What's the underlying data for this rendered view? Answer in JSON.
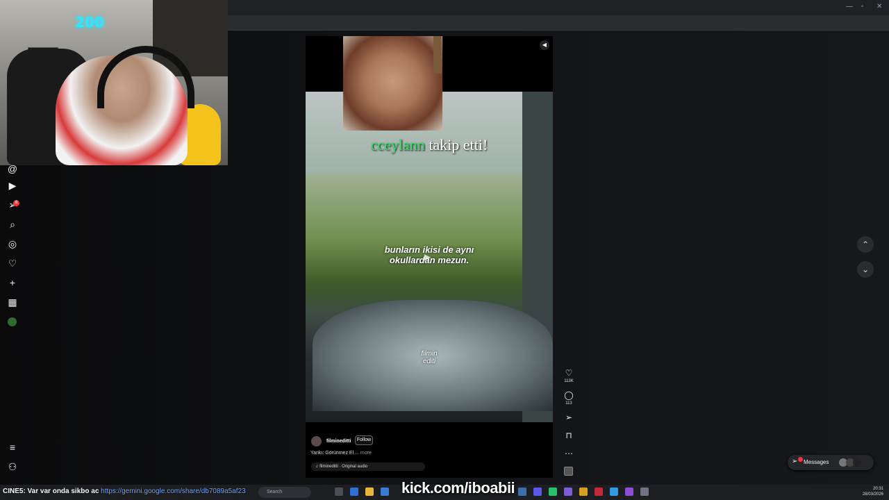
{
  "reel": {
    "follow_alert_user": "cceylann",
    "follow_alert_text": "takip etti!",
    "caption_line1": "bunların ikisi de aynı",
    "caption_line2": "okullardan mezun.",
    "watermark_line1": "filmin",
    "watermark_line2": "editi",
    "author": "filmineditti",
    "follow_label": "Follow",
    "description": "Yankı: Görünmez El ...",
    "more_label": "more",
    "audio": "filmineditti · Original audio"
  },
  "actions": {
    "like_count": "113K",
    "comment_count": "113"
  },
  "messages": {
    "label": "Messages"
  },
  "webcam": {
    "neon_text": "200"
  },
  "taskbar": {
    "search_placeholder": "Search",
    "time": "20:31",
    "date": "28/03/2026"
  },
  "overlay": {
    "chat_user": "CINE5",
    "chat_text": ": Var var onda sikbo ac",
    "chat_link": "https://gemini.google.com/share/db7089a5af23",
    "kick_text": "kick.com/iboabii"
  },
  "colors": {
    "follow_user_green": "#35e06a",
    "badge_red": "#ff3040",
    "link_blue": "#6ea6ff"
  },
  "icons": {
    "nav": [
      "threads-icon",
      "reels-icon",
      "send-icon",
      "search-icon",
      "explore-icon",
      "heart-icon",
      "create-icon",
      "dashboard-icon",
      "profile-avatar",
      "menu-icon",
      "meta-icon"
    ]
  }
}
